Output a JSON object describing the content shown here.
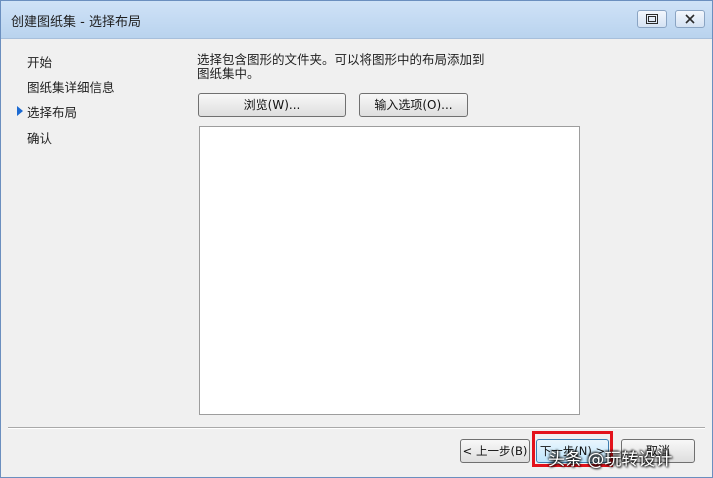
{
  "window": {
    "title": "创建图纸集 - 选择布局"
  },
  "sidebar": {
    "items": [
      {
        "label": "开始"
      },
      {
        "label": "图纸集详细信息"
      },
      {
        "label": "选择布局"
      },
      {
        "label": "确认"
      }
    ]
  },
  "main": {
    "description": "选择包含图形的文件夹。可以将图形中的布局添加到图纸集中。",
    "browse_label": "浏览(W)...",
    "import_options_label": "输入选项(O)..."
  },
  "footer": {
    "back_label": "< 上一步(B)",
    "next_label": "下一步(N) >",
    "cancel_label": "取消"
  },
  "watermark": {
    "text": "头条 @玩转设计"
  },
  "colors": {
    "titlebar": "#c4daf2",
    "highlight_border": "#e3121b",
    "current_step_arrow": "#1b6ad2"
  }
}
